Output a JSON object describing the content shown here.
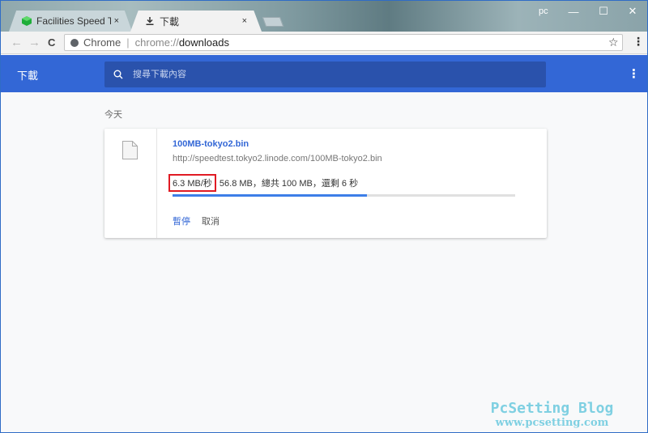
{
  "browser": {
    "tabs": [
      {
        "title": "Facilities Speed Test - Li",
        "favicon": "green-cube-icon",
        "close": "×",
        "active": false
      },
      {
        "title": "下載",
        "favicon": "download-icon",
        "close": "×",
        "active": true
      }
    ],
    "profile": "pc",
    "window_controls": {
      "minimize": "—",
      "maximize": "☐",
      "close": "✕"
    },
    "nav": {
      "back": "←",
      "forward": "→",
      "reload": "C"
    },
    "omnibox": {
      "scheme_label": "Chrome",
      "separator": "|",
      "url_host": "chrome://",
      "url_path": "downloads"
    },
    "bookmark_star": "☆",
    "menu": "⋮"
  },
  "page": {
    "title": "下載",
    "search_placeholder": "搜尋下載內容",
    "more_menu": "⋮",
    "date_header": "今天",
    "downloads": [
      {
        "file_name": "100MB-tokyo2.bin",
        "url": "http://speedtest.tokyo2.linode.com/100MB-tokyo2.bin",
        "speed": "6.3 MB/秒",
        "status_rest": "56.8 MB，總共 100 MB，還剩 6 秒",
        "progress_percent": 56.8,
        "actions": {
          "pause": "暫停",
          "cancel": "取消"
        }
      }
    ]
  },
  "colors": {
    "accent": "#3367d6",
    "highlight_box": "#e01b24",
    "progress": "#3d7ee8"
  },
  "watermark": {
    "line1": "PcSetting Blog",
    "line2": "www.pcsetting.com"
  }
}
